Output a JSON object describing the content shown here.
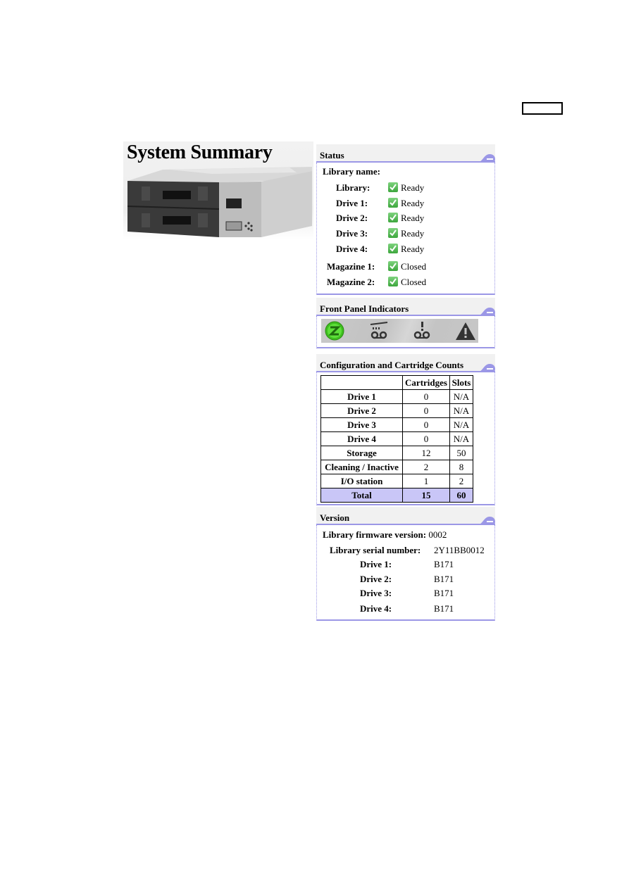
{
  "page": {
    "title": "System Summary",
    "device_image_alt": "Tape library device"
  },
  "status": {
    "title": "Status",
    "library_name_label": "Library name:",
    "library_name_value": "",
    "rows": [
      {
        "label": "Library:",
        "value": "Ready",
        "icon": "check-icon"
      },
      {
        "label": "Drive 1:",
        "value": "Ready",
        "icon": "check-icon"
      },
      {
        "label": "Drive 2:",
        "value": "Ready",
        "icon": "check-icon"
      },
      {
        "label": "Drive 3:",
        "value": "Ready",
        "icon": "check-icon"
      },
      {
        "label": "Drive 4:",
        "value": "Ready",
        "icon": "check-icon"
      },
      {
        "label": "Magazine 1:",
        "value": "Closed",
        "icon": "check-icon"
      },
      {
        "label": "Magazine 2:",
        "value": "Closed",
        "icon": "check-icon"
      }
    ]
  },
  "front_panel": {
    "title": "Front Panel Indicators",
    "indicators": [
      {
        "name": "ready-indicator-icon",
        "state": "on",
        "color": "#44dd22"
      },
      {
        "name": "clean-drive-indicator-icon",
        "state": "off"
      },
      {
        "name": "attention-indicator-icon",
        "state": "off"
      },
      {
        "name": "error-indicator-icon",
        "state": "off"
      }
    ]
  },
  "config": {
    "title": "Configuration and Cartridge Counts",
    "columns": [
      "",
      "Cartridges",
      "Slots"
    ],
    "rows": [
      {
        "label": "Drive 1",
        "cartridges": "0",
        "slots": "N/A"
      },
      {
        "label": "Drive 2",
        "cartridges": "0",
        "slots": "N/A"
      },
      {
        "label": "Drive 3",
        "cartridges": "0",
        "slots": "N/A"
      },
      {
        "label": "Drive 4",
        "cartridges": "0",
        "slots": "N/A"
      },
      {
        "label": "Storage",
        "cartridges": "12",
        "slots": "50"
      },
      {
        "label": "Cleaning / Inactive",
        "cartridges": "2",
        "slots": "8"
      },
      {
        "label": "I/O station",
        "cartridges": "1",
        "slots": "2"
      }
    ],
    "total": {
      "label": "Total",
      "cartridges": "15",
      "slots": "60"
    }
  },
  "version": {
    "title": "Version",
    "rows": [
      {
        "label": "Library firmware version:",
        "value": "0002"
      },
      {
        "label": "Library serial number:",
        "value": "2Y11BB0012"
      },
      {
        "label": "Drive 1:",
        "value": "B171"
      },
      {
        "label": "Drive 2:",
        "value": "B171"
      },
      {
        "label": "Drive 3:",
        "value": "B171"
      },
      {
        "label": "Drive 4:",
        "value": "B171"
      }
    ]
  },
  "colors": {
    "accent": "#9b97e6",
    "total_row_bg": "#c9c6f7",
    "panel_header_bg": "#f1f1f1",
    "status_ok": "#3da63d"
  }
}
